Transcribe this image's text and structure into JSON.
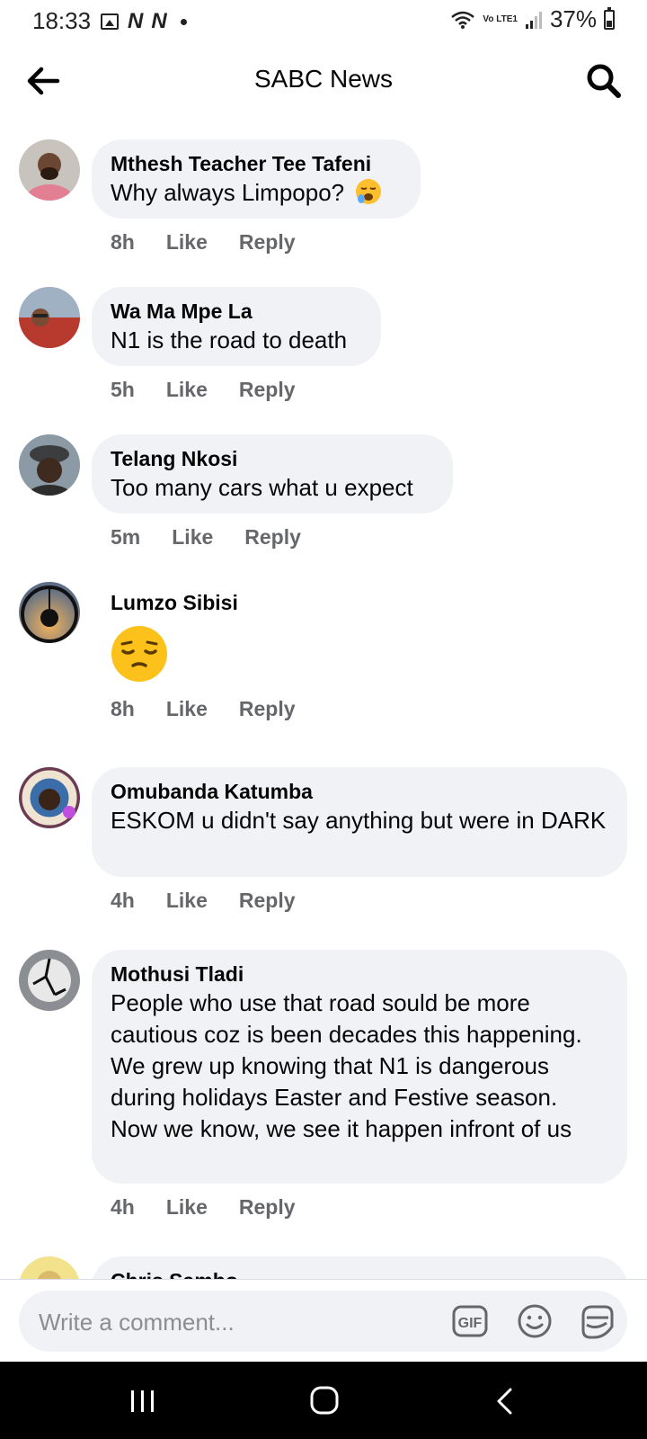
{
  "status_bar": {
    "time": "18:33",
    "network": "Vo LTE1",
    "battery": "37%",
    "icons": [
      "gallery-icon",
      "n-icon",
      "n-icon",
      "dot-icon",
      "wifi-icon",
      "signal-icon",
      "battery-icon"
    ]
  },
  "header": {
    "title": "SABC News",
    "back_icon": "arrow-left-icon",
    "search_icon": "search-icon"
  },
  "comments": [
    {
      "author": "Mthesh Teacher Tee Tafeni",
      "text": "Why always Limpopo?",
      "emoji": "crying-face",
      "time": "8h",
      "like": "Like",
      "reply": "Reply"
    },
    {
      "author": "Wa Ma Mpe La",
      "text": "N1 is the road to death",
      "time": "5h",
      "like": "Like",
      "reply": "Reply"
    },
    {
      "author": "Telang Nkosi",
      "text": "Too many cars what u expect",
      "time": "5m",
      "like": "Like",
      "reply": "Reply"
    },
    {
      "author": "Lumzo Sibisi",
      "text": "",
      "emoji": "pensive-face",
      "time": "8h",
      "like": "Like",
      "reply": "Reply"
    },
    {
      "author": "Omubanda Katumba",
      "text": "ESKOM u didn't say anything but were in DARK",
      "time": "4h",
      "like": "Like",
      "reply": "Reply"
    },
    {
      "author": "Mothusi Tladi",
      "text": "People who use that road sould be more cautious coz is been decades this happening. We grew up knowing that N1 is dangerous during holidays Easter and Festive season. Now we know, we see it happen infront of us",
      "time": "4h",
      "like": "Like",
      "reply": "Reply"
    },
    {
      "author": "Chris Sambo"
    }
  ],
  "composer": {
    "placeholder": "Write a comment...",
    "gif_label": "GIF",
    "icons": [
      "gif-icon",
      "emoji-icon",
      "sticker-icon"
    ]
  },
  "nav_bar": {
    "icons": [
      "recents-icon",
      "home-icon",
      "back-icon"
    ]
  }
}
